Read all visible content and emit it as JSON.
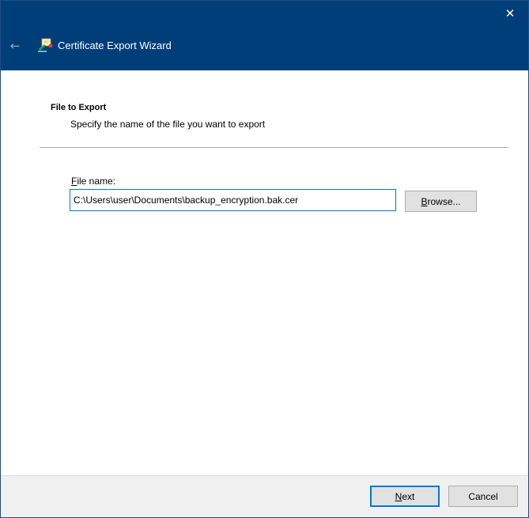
{
  "window": {
    "title": "Certificate Export Wizard",
    "close_glyph": "✕",
    "back_glyph": "←",
    "titlebar_color": "#003e7a",
    "icons": {
      "close": "close-icon",
      "back": "back-arrow-icon",
      "app": "certificate-wizard-icon"
    }
  },
  "page": {
    "section_title": "File to Export",
    "section_description": "Specify the name of the file you want to export"
  },
  "form": {
    "file_label_accesskey": "F",
    "file_label_rest": "ile name:",
    "file_value": "C:\\Users\\user\\Documents\\backup_encryption.bak.cer",
    "browse_accesskey": "B",
    "browse_rest": "rowse..."
  },
  "footer": {
    "next_accesskey": "N",
    "next_rest": "ext",
    "cancel_label": "Cancel",
    "accent_color": "#0078d7"
  }
}
